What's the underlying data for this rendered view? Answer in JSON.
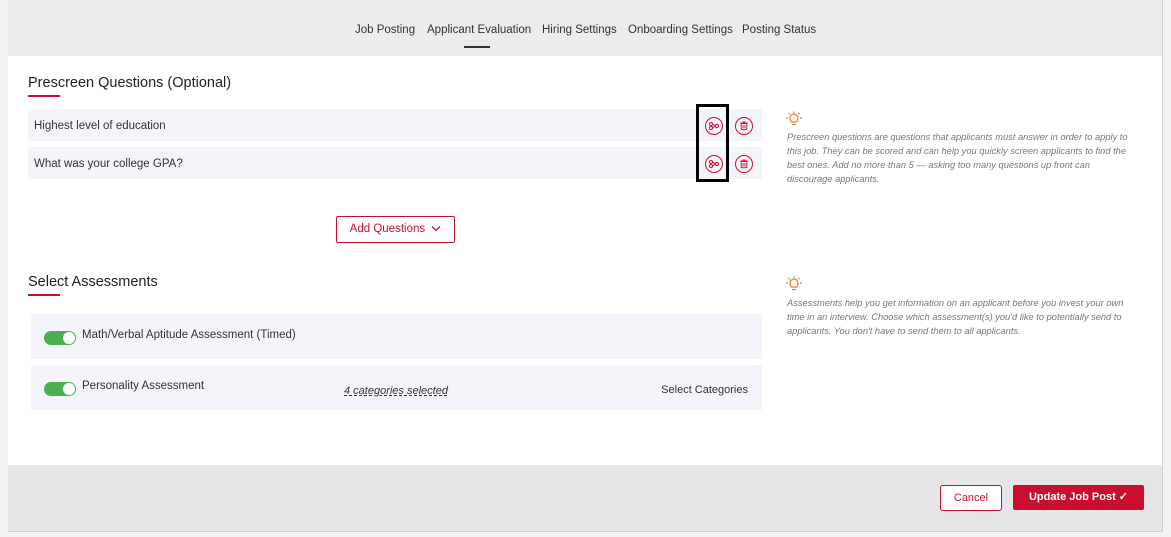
{
  "tabs": [
    {
      "label": "Job Posting"
    },
    {
      "label": "Applicant Evaluation"
    },
    {
      "label": "Hiring Settings"
    },
    {
      "label": "Onboarding Settings"
    },
    {
      "label": "Posting Status"
    }
  ],
  "active_tab": "Applicant Evaluation",
  "prescreen": {
    "title": "Prescreen Questions (Optional)",
    "questions": [
      {
        "text": "Highest level of education"
      },
      {
        "text": "What was your college GPA?"
      }
    ],
    "add_button": "Add Questions",
    "tip": "Prescreen questions are questions that applicants must answer in order to apply to\nthis job. They can be scored and can help you quickly screen applicants to find the\nbest ones. Add no more than 5 — asking too many questions up front can\ndiscourage applicants."
  },
  "assessments": {
    "title": "Select Assessments",
    "items": [
      {
        "label": "Math/Verbal Aptitude Assessment (Timed)",
        "enabled": true
      },
      {
        "label": "Personality Assessment",
        "enabled": true,
        "categories": "4 categories selected",
        "select_label": "Select Categories"
      }
    ],
    "tip": "Assessments help you get information on an applicant before you invest your own\ntime in an interview. Choose which assessment(s) you'd like to potentially send to\napplicants. You don't have to send them to all applicants."
  },
  "footer": {
    "cancel": "Cancel",
    "update": "Update Job Post ✓"
  },
  "colors": {
    "accent": "#c8102e",
    "toggle_on": "#4caf50",
    "tip_icon": "#f07b1f"
  },
  "icons": [
    "branch-logic-icon",
    "trash-icon",
    "lightbulb-icon",
    "chevron-down-icon",
    "checkmark-icon"
  ]
}
